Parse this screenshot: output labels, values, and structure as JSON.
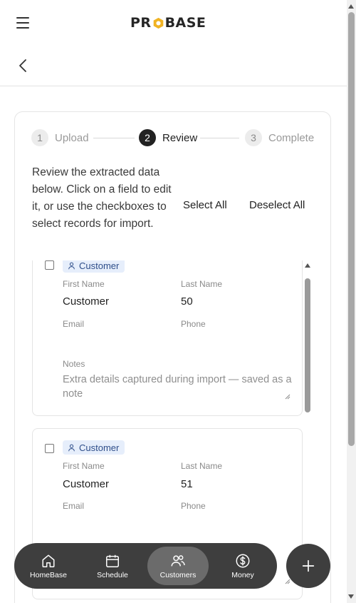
{
  "header": {
    "logo_text": "PROBASE",
    "menu_icon": "hamburger-icon",
    "back_icon": "chevron-left-icon"
  },
  "stepper": {
    "steps": [
      {
        "number": "1",
        "label": "Upload",
        "state": "done"
      },
      {
        "number": "2",
        "label": "Review",
        "state": "active"
      },
      {
        "number": "3",
        "label": "Complete",
        "state": "pending"
      }
    ]
  },
  "review": {
    "instructions": "Review the extracted data below. Click on a field to edit it, or use the checkboxes to select records for import.",
    "select_all_label": "Select All",
    "deselect_all_label": "Deselect All"
  },
  "records": [
    {
      "type_label": "Customer",
      "checked": false,
      "first_name_label": "First Name",
      "first_name": "Customer",
      "last_name_label": "Last Name",
      "last_name": "50",
      "email_label": "Email",
      "email": "",
      "phone_label": "Phone",
      "phone": "",
      "notes_label": "Notes",
      "notes_placeholder": "Extra details captured during import — saved as a note"
    },
    {
      "type_label": "Customer",
      "checked": false,
      "first_name_label": "First Name",
      "first_name": "Customer",
      "last_name_label": "Last Name",
      "last_name": "51",
      "email_label": "Email",
      "email": "",
      "phone_label": "Phone",
      "phone": ""
    }
  ],
  "bottom_nav": {
    "items": [
      {
        "label": "HomeBase",
        "icon": "home-icon",
        "active": false
      },
      {
        "label": "Schedule",
        "icon": "calendar-icon",
        "active": false
      },
      {
        "label": "Customers",
        "icon": "users-icon",
        "active": true
      },
      {
        "label": "Money",
        "icon": "dollar-icon",
        "active": false
      }
    ],
    "fab_icon": "plus-icon"
  },
  "colors": {
    "nav_bg": "#3e3e3e",
    "nav_active": "#6b6b6b",
    "badge_bg": "#e6eefb",
    "badge_text": "#2f4e8a",
    "step_active": "#222222"
  }
}
